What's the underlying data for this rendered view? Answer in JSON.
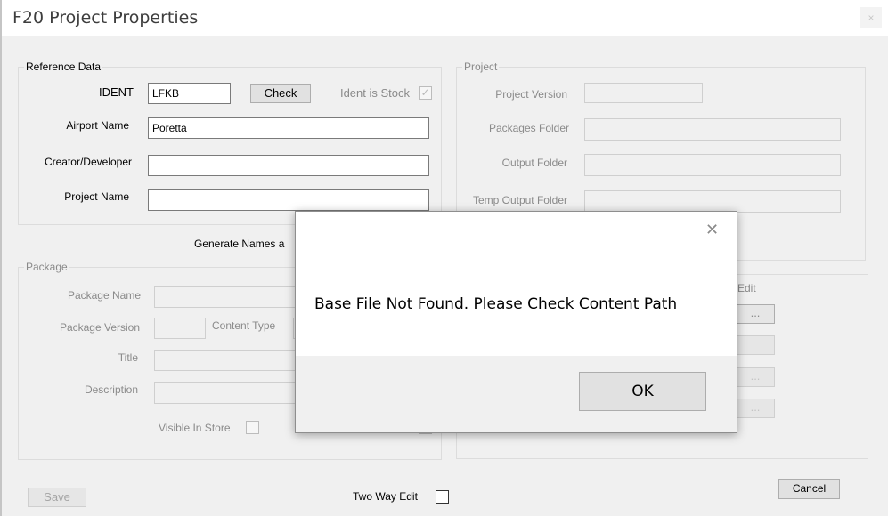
{
  "window": {
    "title": "F20 Project Properties",
    "close_glyph": "×"
  },
  "reference": {
    "legend": "Reference Data",
    "ident_label": "IDENT",
    "ident_value": "LFKB",
    "check_label": "Check",
    "ident_stock_label": "Ident is Stock",
    "ident_stock_mark": "✓",
    "airport_label": "Airport Name",
    "airport_value": "Poretta",
    "creator_label": "Creator/Developer",
    "creator_value": "",
    "project_name_label": "Project Name",
    "project_name_value": ""
  },
  "generate_text": "Generate Names a",
  "project": {
    "legend": "Project",
    "version_label": "Project Version",
    "packages_label": "Packages Folder",
    "output_label": "Output Folder",
    "temp_output_label": "Temp Output Folder"
  },
  "package": {
    "legend": "Package",
    "name_label": "Package Name",
    "version_label": "Package Version",
    "content_type_label": "Content Type",
    "title_label": "Title",
    "description_label": "Description",
    "visible_label": "Visible In Store"
  },
  "right_group": {
    "edit_label": "Edit",
    "button_dots": "..."
  },
  "footer": {
    "save_label": "Save",
    "two_way_label": "Two Way Edit",
    "cancel_label": "Cancel"
  },
  "dialog": {
    "close_glyph": "✕",
    "message": "Base File Not Found.  Please Check Content Path",
    "ok_label": "OK"
  }
}
